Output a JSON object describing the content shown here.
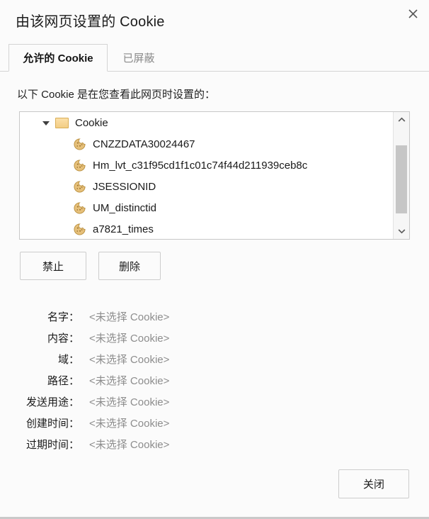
{
  "dialog": {
    "title": "由该网页设置的 Cookie",
    "close_icon": "close-icon"
  },
  "tabs": [
    {
      "label": "允许的 Cookie",
      "name": "tab-allowed-cookies",
      "active": true
    },
    {
      "label": "已屏蔽",
      "name": "tab-blocked",
      "active": false
    }
  ],
  "description": "以下 Cookie 是在您查看此网页时设置的：",
  "cookie_tree": {
    "root": {
      "label": "Cookie",
      "expanded": true,
      "icon": "folder-icon"
    },
    "items": [
      {
        "label": "CNZZDATA30024467",
        "icon": "cookie-icon"
      },
      {
        "label": "Hm_lvt_c31f95cd1f1c01c74f44d211939ceb8c",
        "icon": "cookie-icon"
      },
      {
        "label": "JSESSIONID",
        "icon": "cookie-icon"
      },
      {
        "label": "UM_distinctid",
        "icon": "cookie-icon"
      },
      {
        "label": "a7821_times",
        "icon": "cookie-icon"
      }
    ]
  },
  "scrollbar": {
    "up_icon": "chevron-up-icon",
    "down_icon": "chevron-down-icon"
  },
  "actions": {
    "block_label": "禁止",
    "remove_label": "删除",
    "close_label": "关闭"
  },
  "details": {
    "placeholder": "<未选择 Cookie>",
    "rows": [
      {
        "label": "名字：",
        "value": "<未选择 Cookie>"
      },
      {
        "label": "内容：",
        "value": "<未选择 Cookie>"
      },
      {
        "label": "域：",
        "value": "<未选择 Cookie>"
      },
      {
        "label": "路径：",
        "value": "<未选择 Cookie>"
      },
      {
        "label": "发送用途：",
        "value": "<未选择 Cookie>"
      },
      {
        "label": "创建时间：",
        "value": "<未选择 Cookie>"
      },
      {
        "label": "过期时间：",
        "value": "<未选择 Cookie>"
      }
    ]
  },
  "colors": {
    "background": "#fbfbfb",
    "text": "#1a1a1a",
    "muted": "#8d8d8d",
    "border": "#d4d4d4",
    "cookie_gold": "#e0b45e"
  }
}
